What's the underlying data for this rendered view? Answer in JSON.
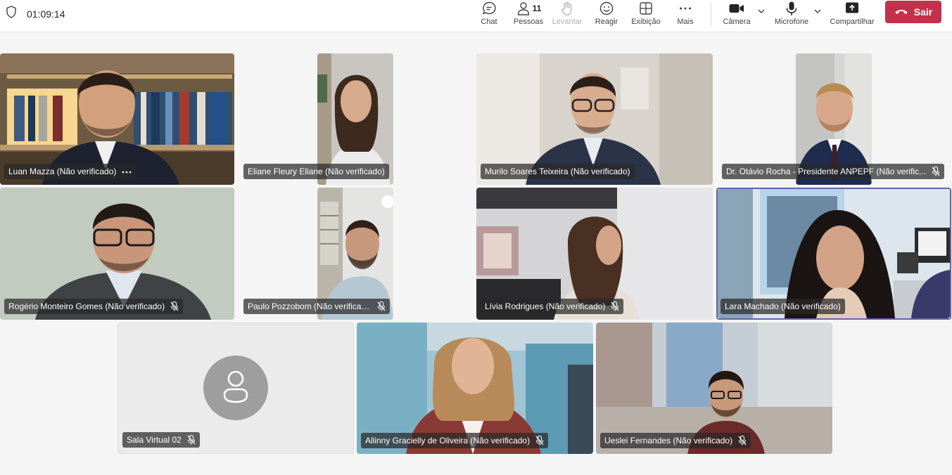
{
  "meeting": {
    "timer": "01:09:14",
    "shield_icon": "shield-icon"
  },
  "toolbar": {
    "chat_label": "Chat",
    "people_label": "Pessoas",
    "people_count": "11",
    "raise_label": "Levantar",
    "react_label": "Reagir",
    "view_label": "Exibição",
    "more_label": "Mais",
    "camera_label": "Câmera",
    "mic_label": "Microfone",
    "share_label": "Compartilhar",
    "leave_label": "Sair"
  },
  "colors": {
    "leave": "#c4314b",
    "active_border": "#6264a7",
    "avatar_bg": "#9e9e9e"
  },
  "participants": [
    {
      "name": "Luan Mazza (Não verificado)",
      "muted": false,
      "has_more": true
    },
    {
      "name": "Eliane Fleury Eliane (Não verificado)",
      "muted": false
    },
    {
      "name": "Murilo Soares Teixeira (Não verificado)",
      "muted": false
    },
    {
      "name": "Dr. Otávio Rocha - Presidente ANPEPF (Não verific...",
      "muted": true
    },
    {
      "name": "Rogério Monteiro Gomes (Não verificado)",
      "muted": true
    },
    {
      "name": "Paulo Pozzobom (Não verificado)",
      "muted": true
    },
    {
      "name": "Lívia Rodrigues (Não verificado)",
      "muted": true
    },
    {
      "name": "Lara Machado (Não verificado)",
      "muted": false,
      "active": true
    },
    {
      "name": "Sala Virtual 02",
      "muted": true,
      "avatar": true
    },
    {
      "name": "Allinny Gracielly de Oliveira (Não verificado)",
      "muted": true
    },
    {
      "name": "Ueslei Fernandes (Não verificado)",
      "muted": true
    }
  ]
}
